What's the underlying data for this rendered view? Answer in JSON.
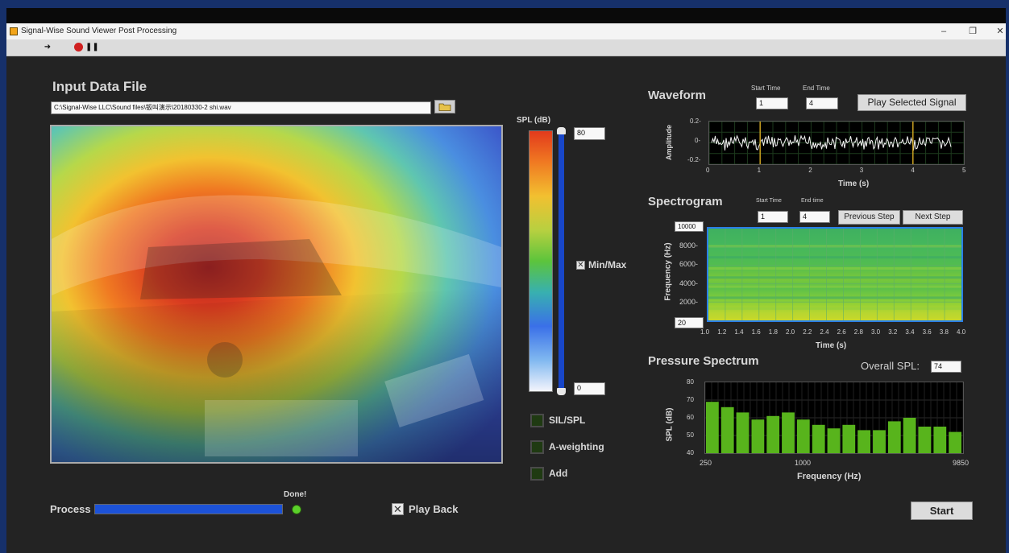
{
  "window": {
    "title": "Signal-Wise Sound Viewer Post Processing"
  },
  "input": {
    "heading": "Input Data File",
    "path": "C:\\Signal-Wise LLC\\Sound files\\钣叫演示\\20180330-2 shi.wav"
  },
  "scale": {
    "label": "SPL (dB)",
    "max_value": "80",
    "min_value": "0",
    "minmax_label": "Min/Max"
  },
  "options": [
    {
      "label": "SIL/SPL"
    },
    {
      "label": "A-weighting"
    },
    {
      "label": "Add"
    }
  ],
  "process": {
    "label": "Process",
    "done_label": "Done!",
    "progress": 1.0,
    "led_color": "#5bd12a"
  },
  "playback": {
    "label": "Play Back",
    "checked": true
  },
  "waveform": {
    "heading": "Waveform",
    "start_label": "Start Time",
    "end_label": "End Time",
    "start_value": "1",
    "end_value": "4",
    "play_button": "Play Selected Signal",
    "ylabel": "Amplitude",
    "xlabel": "Time (s)",
    "yticks": [
      "0.2-",
      "0-",
      "-0.2-"
    ],
    "xticks": [
      "0",
      "1",
      "2",
      "3",
      "4",
      "5"
    ]
  },
  "spectrogram": {
    "heading": "Spectrogram",
    "start_label": "Start Time",
    "end_label": "End time",
    "start_value": "1",
    "end_value": "4",
    "prev_button": "Previous Step",
    "next_button": "Next Step",
    "ylabel": "Frequency (Hz)",
    "xlabel": "Time (s)",
    "ymax_value": "10000",
    "ymin_value": "20",
    "yticks": [
      "8000-",
      "6000-",
      "4000-",
      "2000-"
    ],
    "xticks": [
      "1.0",
      "1.2",
      "1.4",
      "1.6",
      "1.8",
      "2.0",
      "2.2",
      "2.4",
      "2.6",
      "2.8",
      "3.0",
      "3.2",
      "3.4",
      "3.6",
      "3.8",
      "4.0"
    ]
  },
  "spectrum": {
    "heading": "Pressure Spectrum",
    "overall_label": "Overall SPL:",
    "overall_value": "74",
    "start_button": "Start",
    "bar_color": "#58b41c"
  },
  "chart_data": {
    "type": "bar",
    "xlabel": "Frequency (Hz)",
    "ylabel": "SPL (dB)",
    "ylim": [
      40,
      80
    ],
    "yticks": [
      "80",
      "70",
      "60",
      "50",
      "40"
    ],
    "xtick_labels": [
      "250",
      "1000",
      "9850"
    ],
    "values": [
      69,
      66,
      63,
      59,
      61,
      63,
      59,
      56,
      54,
      56,
      53,
      53,
      58,
      60,
      55,
      55,
      52
    ]
  }
}
